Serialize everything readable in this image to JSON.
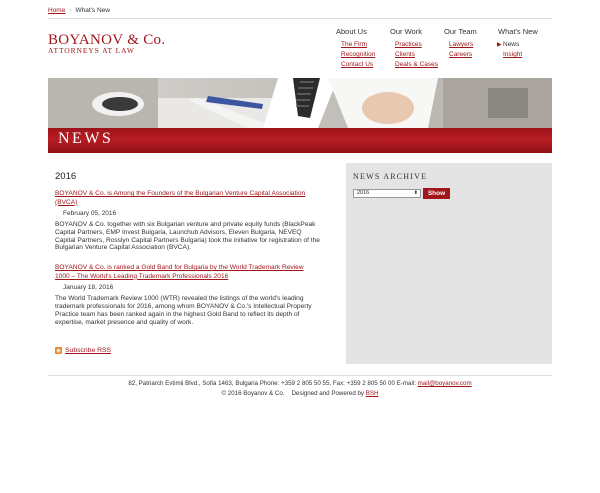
{
  "breadcrumb": {
    "home": "Home",
    "separator": "›",
    "current": "What's New"
  },
  "logo": {
    "name": "BOYANOV & Co.",
    "tagline": "ATTORNEYS  AT  LAW"
  },
  "nav": [
    {
      "head": "About Us",
      "items": [
        "The Firm",
        "Recognition",
        "Contact Us"
      ]
    },
    {
      "head": "Our Work",
      "items": [
        "Practices",
        "Clients",
        "Deals & Cases"
      ]
    },
    {
      "head": "Our Team",
      "items": [
        "Lawyers",
        "Careers"
      ]
    },
    {
      "head": "What's New",
      "current": "News",
      "items": [
        "Insight"
      ]
    }
  ],
  "banner": {
    "title": "NEWS"
  },
  "content": {
    "year": "2016",
    "items": [
      {
        "title": "BOYANOV & Co. is Among the Founders of the Bulgarian Venture Capital Association (BVCA)",
        "date": "February 05, 2016",
        "body": "BOYANOV & Co. together with six Bulgarian venture and private equity funds (BlackPeak Capital Partners, EMP Invest Bulgaria, Launchub Advisors, Eleven Bulgaria, NEVEQ Capital Partners, Rosslyn Capital Partners Bulgaria) took the initiative for registration of the Bulgarian Venture Capital Association (BVCA)."
      },
      {
        "title": "BOYANOV & Co. is ranked a Gold Band for Bulgaria by the World Trademark Review 1000 – The World's Leading Trademark Professionals 2016",
        "date": "January 18, 2016",
        "body": "The World Trademark Review 1000 (WTR) revealed the listings of the world's leading trademark professionals for 2016, among whom BOYANOV & Co.'s Intellectual Property Practice team has been ranked again in the highest Gold Band to reflect its depth of expertise, market presence and quality of work."
      }
    ],
    "rss": "Subscribe RSS"
  },
  "archive": {
    "title": "NEWS  ARCHIVE",
    "selected_year": "2016",
    "button": "Show"
  },
  "footer": {
    "address": "82, Patriarch Evtimii Blvd., Sofia 1463, Bulgaria Phone: +359 2 805 50 55, Fax: +359 2 805 50 00 E-mail:",
    "email": "mail@boyanov.com",
    "copyright": "© 2016 Boyanov & Co.",
    "powered": "Designed and Powered by",
    "powered_by": "BSH"
  },
  "colors": {
    "brand": "#a0161b",
    "archive_bg": "#e4e4e4"
  }
}
